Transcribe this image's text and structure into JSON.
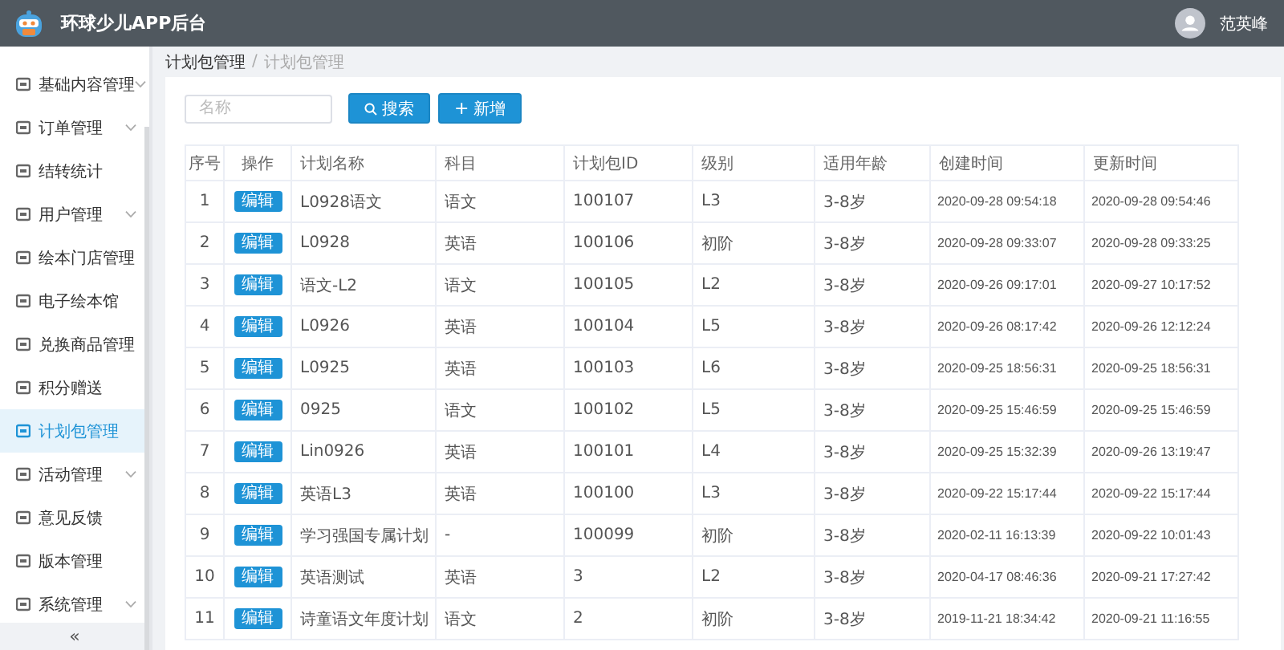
{
  "header": {
    "title": "环球少儿APP后台",
    "user": "范英峰"
  },
  "sidebar": {
    "items": [
      {
        "label": "基础内容管理",
        "expandable": true,
        "selected": false
      },
      {
        "label": "订单管理",
        "expandable": true,
        "selected": false
      },
      {
        "label": "结转统计",
        "expandable": false,
        "selected": false
      },
      {
        "label": "用户管理",
        "expandable": true,
        "selected": false
      },
      {
        "label": "绘本门店管理",
        "expandable": false,
        "selected": false
      },
      {
        "label": "电子绘本馆",
        "expandable": false,
        "selected": false
      },
      {
        "label": "兑换商品管理",
        "expandable": false,
        "selected": false
      },
      {
        "label": "积分赠送",
        "expandable": false,
        "selected": false
      },
      {
        "label": "计划包管理",
        "expandable": false,
        "selected": true
      },
      {
        "label": "活动管理",
        "expandable": true,
        "selected": false
      },
      {
        "label": "意见反馈",
        "expandable": false,
        "selected": false
      },
      {
        "label": "版本管理",
        "expandable": false,
        "selected": false
      },
      {
        "label": "系统管理",
        "expandable": true,
        "selected": false
      }
    ],
    "collapse": "«"
  },
  "breadcrumb": {
    "items": [
      "计划包管理",
      "计划包管理"
    ],
    "separator": "/"
  },
  "search": {
    "placeholder": "名称",
    "search_button": "搜索",
    "add_button": "新增",
    "add_symbol": "+"
  },
  "table": {
    "columns": [
      "序号",
      "操作",
      "计划名称",
      "科目",
      "计划包ID",
      "级别",
      "适用年龄",
      "创建时间",
      "更新时间"
    ],
    "rows": [
      [
        "1",
        "编辑",
        "L0928语文",
        "语文",
        "100107",
        "L3",
        "3-8岁",
        "2020-09-28 09:54:18",
        "2020-09-28 09:54:46"
      ],
      [
        "2",
        "编辑",
        "L0928",
        "英语",
        "100106",
        "初阶",
        "3-8岁",
        "2020-09-28 09:33:07",
        "2020-09-28 09:33:25"
      ],
      [
        "3",
        "编辑",
        "语文-L2",
        "语文",
        "100105",
        "L2",
        "3-8岁",
        "2020-09-26 09:17:01",
        "2020-09-27 10:17:52"
      ],
      [
        "4",
        "编辑",
        "L0926",
        "英语",
        "100104",
        "L5",
        "3-8岁",
        "2020-09-26 08:17:42",
        "2020-09-26 12:12:24"
      ],
      [
        "5",
        "编辑",
        "L0925",
        "英语",
        "100103",
        "L6",
        "3-8岁",
        "2020-09-25 18:56:31",
        "2020-09-25 18:56:31"
      ],
      [
        "6",
        "编辑",
        "0925",
        "语文",
        "100102",
        "L5",
        "3-8岁",
        "2020-09-25 15:46:59",
        "2020-09-25 15:46:59"
      ],
      [
        "7",
        "编辑",
        "Lin0926",
        "英语",
        "100101",
        "L4",
        "3-8岁",
        "2020-09-25 15:32:39",
        "2020-09-26 13:19:47"
      ],
      [
        "8",
        "编辑",
        "英语L3",
        "英语",
        "100100",
        "L3",
        "3-8岁",
        "2020-09-22 15:17:44",
        "2020-09-22 15:17:44"
      ],
      [
        "9",
        "编辑",
        "学习强国专属计划",
        "-",
        "100099",
        "初阶",
        "3-8岁",
        "2020-02-11 16:13:39",
        "2020-09-22 10:01:43"
      ],
      [
        "10",
        "编辑",
        "英语测试",
        "英语",
        "3",
        "L2",
        "3-8岁",
        "2020-04-17 08:46:36",
        "2020-09-21 17:27:42"
      ],
      [
        "11",
        "编辑",
        "诗童语文年度计划",
        "语文",
        "2",
        "初阶",
        "3-8岁",
        "2019-11-21 18:34:42",
        "2020-09-21 11:16:55"
      ]
    ]
  }
}
